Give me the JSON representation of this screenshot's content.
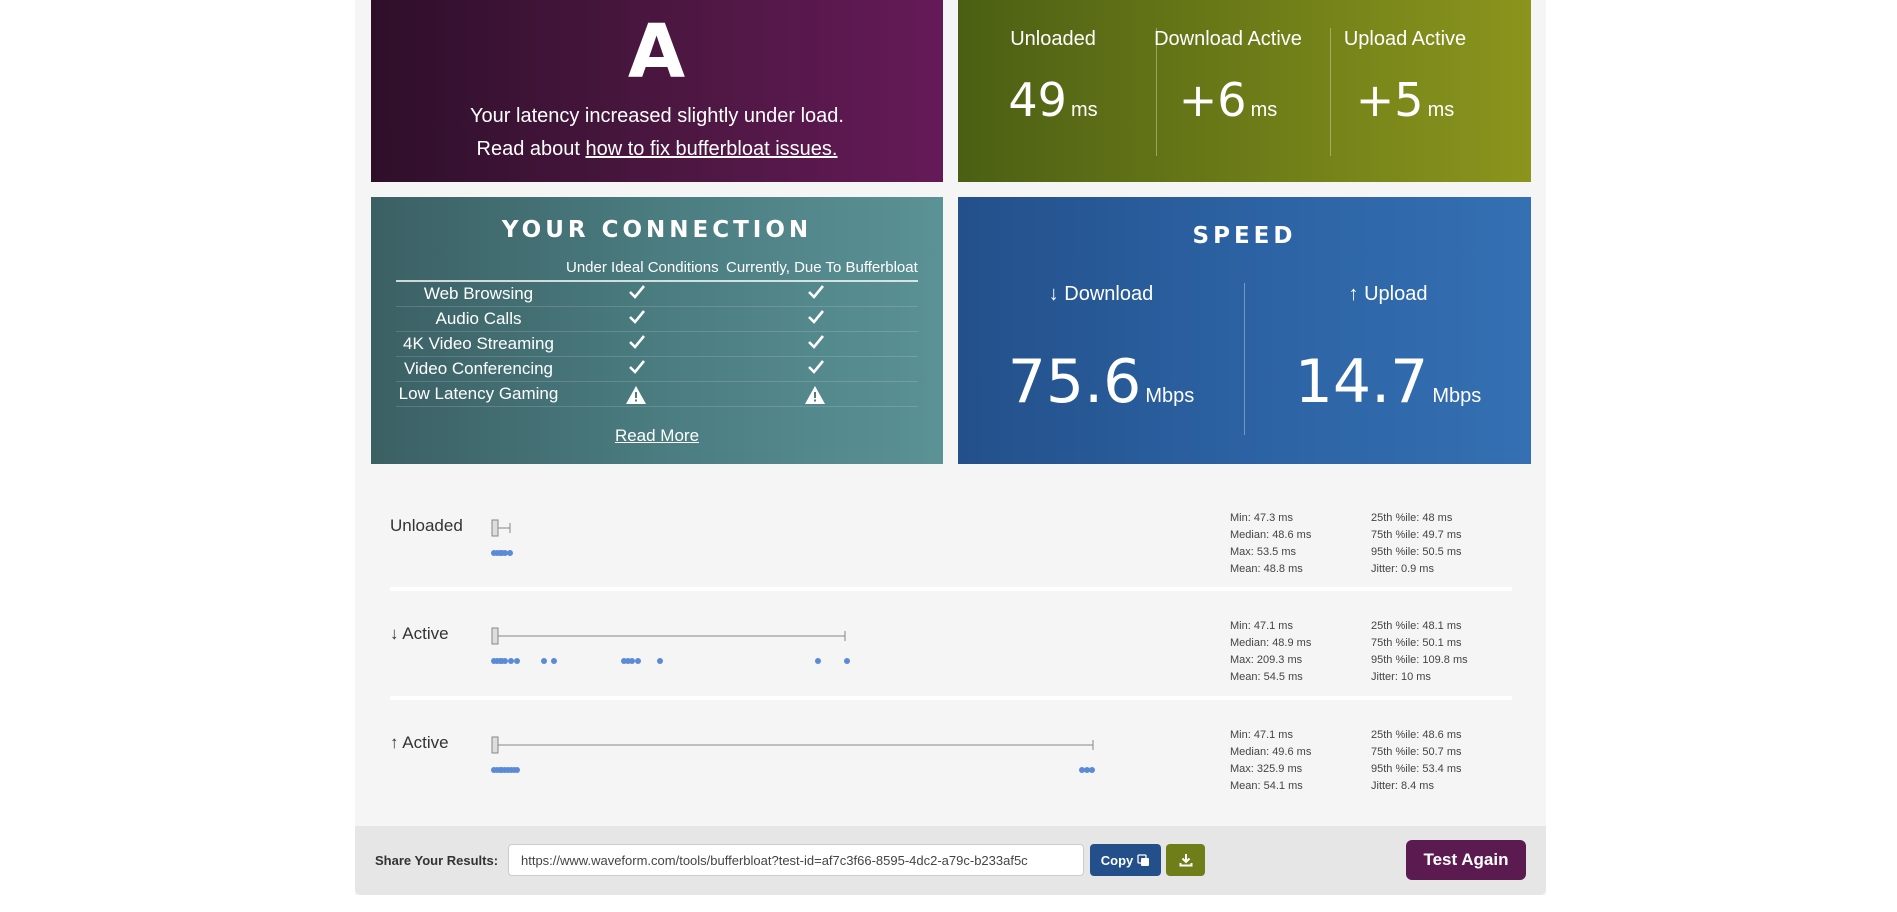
{
  "grade": {
    "letter": "A",
    "line1": "Your latency increased slightly under load.",
    "line2_prefix": "Read about ",
    "line2_link": "how to fix bufferbloat issues."
  },
  "latency": {
    "unloaded": {
      "label": "Unloaded",
      "value": "49",
      "unit": "ms"
    },
    "download": {
      "label": "Download Active",
      "value": "+6",
      "unit": "ms"
    },
    "upload": {
      "label": "Upload Active",
      "value": "+5",
      "unit": "ms"
    }
  },
  "connection": {
    "title": "YOUR CONNECTION",
    "col1": "Under Ideal Conditions",
    "col2": "Currently, Due To Bufferbloat",
    "rows": [
      {
        "name": "Web Browsing",
        "ideal": "ok",
        "current": "ok"
      },
      {
        "name": "Audio Calls",
        "ideal": "ok",
        "current": "ok"
      },
      {
        "name": "4K Video Streaming",
        "ideal": "ok",
        "current": "ok"
      },
      {
        "name": "Video Conferencing",
        "ideal": "ok",
        "current": "ok"
      },
      {
        "name": "Low Latency Gaming",
        "ideal": "warn",
        "current": "warn"
      }
    ],
    "read_more": "Read More"
  },
  "speed": {
    "title": "SPEED",
    "download": {
      "label": "↓ Download",
      "value": "75.6",
      "unit": "Mbps"
    },
    "upload": {
      "label": "↑ Upload",
      "value": "14.7",
      "unit": "Mbps"
    }
  },
  "latency_rows": [
    {
      "label": "Unloaded",
      "stats_left": [
        "Min: 47.3 ms",
        "Median: 48.6 ms",
        "Max: 53.5 ms",
        "Mean: 48.8 ms"
      ],
      "stats_right": [
        "25th %ile: 48 ms",
        "75th %ile: 49.7 ms",
        "95th %ile: 50.5 ms",
        "Jitter: 0.9 ms"
      ],
      "max_ms": 53.5
    },
    {
      "label": "↓ Active",
      "stats_left": [
        "Min: 47.1 ms",
        "Median: 48.9 ms",
        "Max: 209.3 ms",
        "Mean: 54.5 ms"
      ],
      "stats_right": [
        "25th %ile: 48.1 ms",
        "75th %ile: 50.1 ms",
        "95th %ile: 109.8 ms",
        "Jitter: 10 ms"
      ],
      "max_ms": 209.3
    },
    {
      "label": "↑ Active",
      "stats_left": [
        "Min: 47.1 ms",
        "Median: 49.6 ms",
        "Max: 325.9 ms",
        "Mean: 54.1 ms"
      ],
      "stats_right": [
        "25th %ile: 48.6 ms",
        "75th %ile: 50.7 ms",
        "95th %ile: 53.4 ms",
        "Jitter: 8.4 ms"
      ],
      "max_ms": 325.9
    }
  ],
  "share": {
    "label": "Share Your Results:",
    "url": "https://www.waveform.com/tools/bufferbloat?test-id=af7c3f66-8595-4dc2-a79c-b233af5c",
    "copy_label": "Copy",
    "download_icon": "download-icon",
    "test_again": "Test Again"
  },
  "colors": {
    "grade_bg": "#4d1742",
    "latency_bg": "#6f7e18",
    "connection_bg": "#4a7c80",
    "speed_bg": "#2c62a3",
    "dot_color": "#5b8ad6"
  }
}
